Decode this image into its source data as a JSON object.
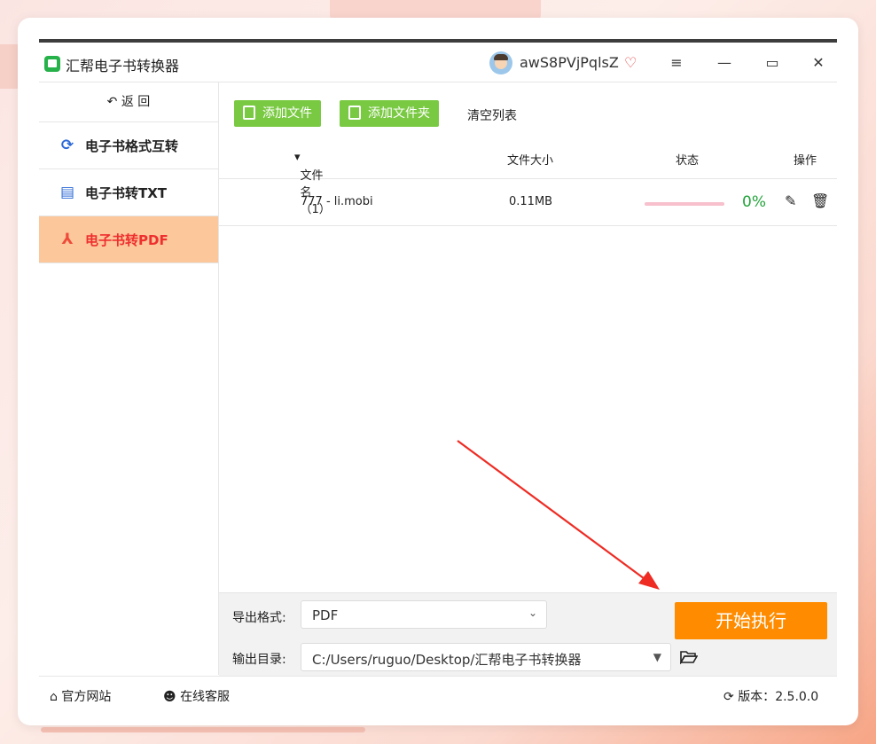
{
  "app": {
    "title": "汇帮电子书转换器"
  },
  "user": {
    "name": "awS8PVjPqlsZ"
  },
  "window": {
    "menu_icon": "≡",
    "minimize_icon": "—",
    "maximize_icon": "▭",
    "close_icon": "✕"
  },
  "sidebar": {
    "back_label": "返 回",
    "items": [
      {
        "label": "电子书格式互转",
        "icon": "refresh-icon"
      },
      {
        "label": "电子书转TXT",
        "icon": "document-icon"
      },
      {
        "label": "电子书转PDF",
        "icon": "pdf-icon",
        "active": true
      }
    ]
  },
  "toolbar": {
    "add_file": "添加文件",
    "add_folder": "添加文件夹",
    "clear_list": "清空列表"
  },
  "table": {
    "headers": {
      "name": "文件名（1）",
      "size": "文件大小",
      "status": "状态",
      "actions": "操作"
    },
    "rows": [
      {
        "name": "777 - li.mobi",
        "size": "0.11MB",
        "progress": 0,
        "percent": "0%"
      }
    ]
  },
  "settings": {
    "format_label": "导出格式:",
    "format_value": "PDF",
    "output_label": "输出目录:",
    "output_value": "C:/Users/ruguo/Desktop/汇帮电子书转换器",
    "start_button": "开始执行"
  },
  "footer": {
    "website": "官方网站",
    "support": "在线客服",
    "version_label": "版本：",
    "version": "2.5.0.0"
  },
  "colors": {
    "accent": "#ff8c00",
    "green": "#7ac943",
    "active_bg": "#fbc79b",
    "active_text": "#ef2f2f"
  }
}
